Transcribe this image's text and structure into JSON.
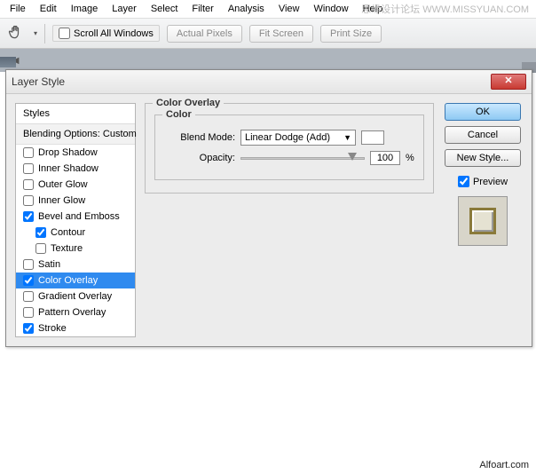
{
  "watermark": "思缘设计论坛  WWW.MISSYUAN.COM",
  "menu": [
    "File",
    "Edit",
    "Image",
    "Layer",
    "Select",
    "Filter",
    "Analysis",
    "View",
    "Window",
    "Help"
  ],
  "toolbar": {
    "scroll_all": "Scroll All Windows",
    "actual_pixels": "Actual Pixels",
    "fit_screen": "Fit Screen",
    "print_size": "Print Size"
  },
  "dialog": {
    "title": "Layer Style",
    "list_header": "Styles",
    "blend_line": "Blending Options: Custom",
    "items": [
      {
        "label": "Drop Shadow",
        "checked": false,
        "indent": false
      },
      {
        "label": "Inner Shadow",
        "checked": false,
        "indent": false
      },
      {
        "label": "Outer Glow",
        "checked": false,
        "indent": false
      },
      {
        "label": "Inner Glow",
        "checked": false,
        "indent": false
      },
      {
        "label": "Bevel and Emboss",
        "checked": true,
        "indent": false
      },
      {
        "label": "Contour",
        "checked": true,
        "indent": true
      },
      {
        "label": "Texture",
        "checked": false,
        "indent": true
      },
      {
        "label": "Satin",
        "checked": false,
        "indent": false
      },
      {
        "label": "Color Overlay",
        "checked": true,
        "indent": false,
        "selected": true
      },
      {
        "label": "Gradient Overlay",
        "checked": false,
        "indent": false
      },
      {
        "label": "Pattern Overlay",
        "checked": false,
        "indent": false
      },
      {
        "label": "Stroke",
        "checked": true,
        "indent": false
      }
    ],
    "group_title": "Color Overlay",
    "subgroup_title": "Color",
    "blend_mode_label": "Blend Mode:",
    "blend_mode_value": "Linear Dodge (Add)",
    "opacity_label": "Opacity:",
    "opacity_value": "100",
    "opacity_unit": "%",
    "ok": "OK",
    "cancel": "Cancel",
    "new_style": "New Style...",
    "preview": "Preview"
  },
  "footer": "Alfoart.com"
}
